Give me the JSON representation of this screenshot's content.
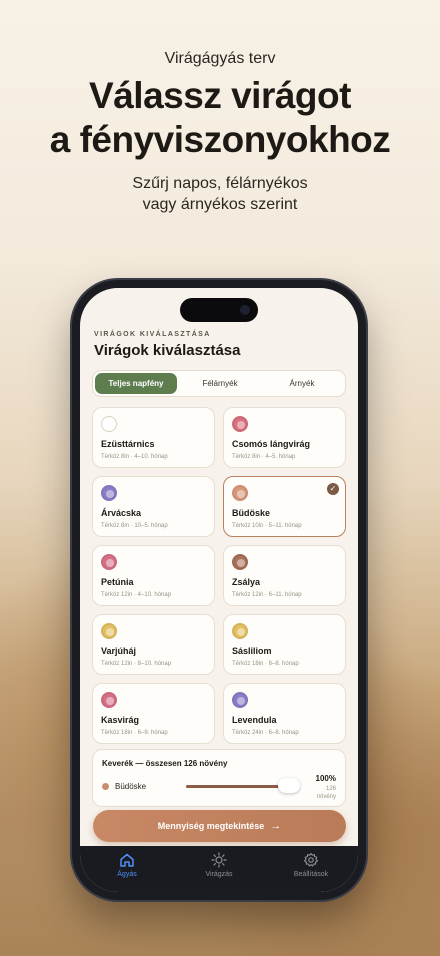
{
  "hero": {
    "kicker": "Virágágyás terv",
    "title_line1": "Válassz virágot",
    "title_line2": "a fényviszonyokhoz",
    "subtitle_line1": "Szűrj napos, félárnyékos",
    "subtitle_line2": "vagy árnyékos szerint"
  },
  "screen": {
    "eyebrow": "VIRÁGOK KIVÁLASZTÁSA",
    "title": "Virágok kiválasztása"
  },
  "filters": [
    {
      "label": "Teljes napfény",
      "active": true
    },
    {
      "label": "Félárnyék",
      "active": false
    },
    {
      "label": "Árnyék",
      "active": false
    }
  ],
  "flowers": [
    {
      "name": "Ezüsttárnics",
      "meta": "Térköz 8in · 4–10. hónap",
      "color": "#ffffff",
      "selected": false
    },
    {
      "name": "Csomós lángvirág",
      "meta": "Térköz 8in · 4–5. hónap",
      "color": "#d9707f",
      "selected": false
    },
    {
      "name": "Árvácska",
      "meta": "Térköz 8in · 10–5. hónap",
      "color": "#8a7cc6",
      "selected": false
    },
    {
      "name": "Büdöske",
      "meta": "Térköz 10in · 5–11. hónap",
      "color": "#d8967a",
      "selected": true
    },
    {
      "name": "Petúnia",
      "meta": "Térköz 12in · 4–10. hónap",
      "color": "#d56f86",
      "selected": false
    },
    {
      "name": "Zsálya",
      "meta": "Térköz 12in · 6–11. hónap",
      "color": "#a8705a",
      "selected": false
    },
    {
      "name": "Varjúháj",
      "meta": "Térköz 12in · 8–10. hónap",
      "color": "#e3bf62",
      "selected": false
    },
    {
      "name": "Sásliliom",
      "meta": "Térköz 18in · 6–8. hónap",
      "color": "#e3bf62",
      "selected": false
    },
    {
      "name": "Kasvirág",
      "meta": "Térköz 18in · 6–9. hónap",
      "color": "#d56f86",
      "selected": false
    },
    {
      "name": "Levendula",
      "meta": "Térköz 24in · 6–8. hónap",
      "color": "#8a7cc6",
      "selected": false
    }
  ],
  "mix": {
    "title": "Keverék — összesen 126 növény",
    "item_name": "Büdöske",
    "item_color": "#c98e6c",
    "percent": "100%",
    "percent_value": 100,
    "count": "126 növény"
  },
  "cta": {
    "label": "Mennyiség megtekintése",
    "arrow": "→"
  },
  "tabs": [
    {
      "label": "Ágyás",
      "icon": "home-icon",
      "active": true
    },
    {
      "label": "Virágzás",
      "icon": "sun-icon",
      "active": false
    },
    {
      "label": "Beállítások",
      "icon": "gear-icon",
      "active": false
    }
  ],
  "colors": {
    "accent": "#5e7d4f",
    "cta": "#c98865",
    "tab_active": "#4f8ff7",
    "selected_border": "#b9805f"
  }
}
